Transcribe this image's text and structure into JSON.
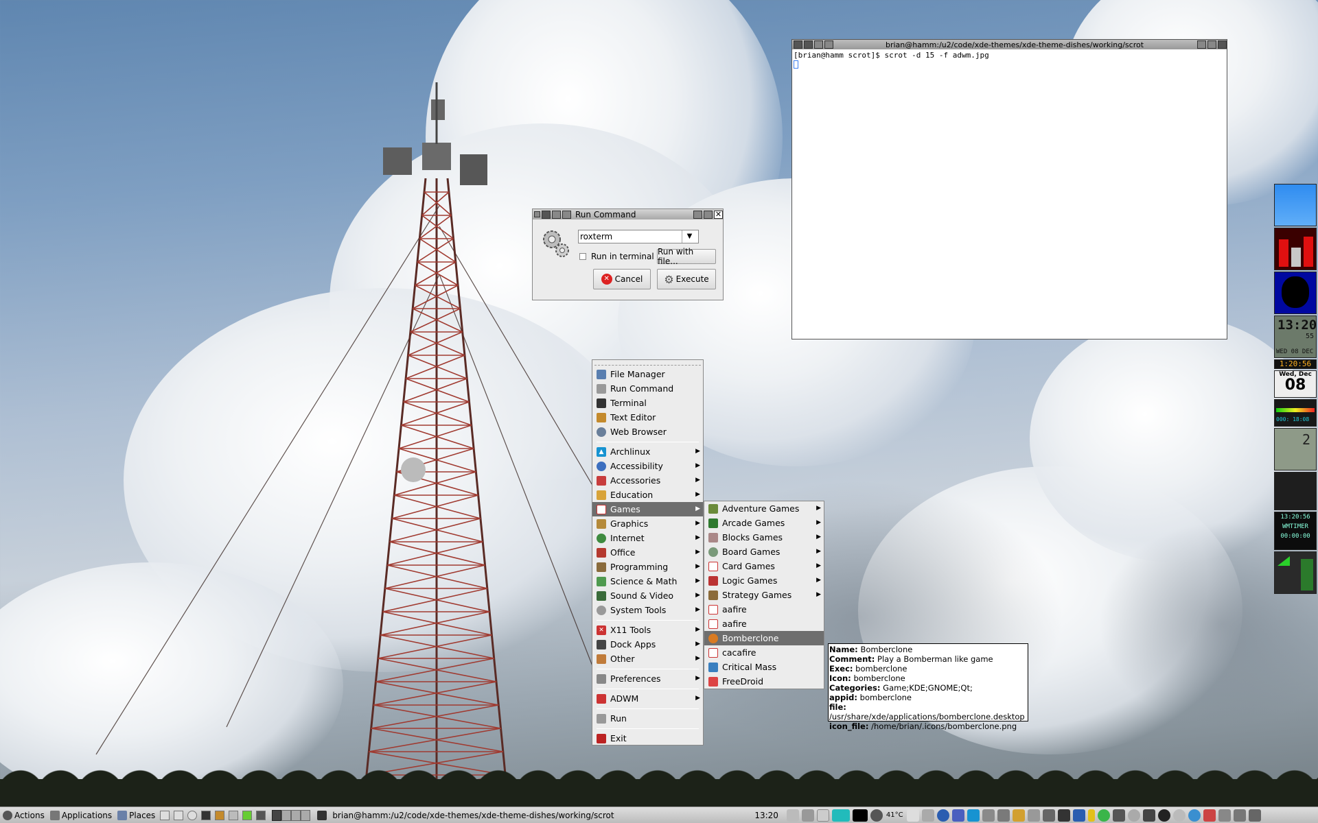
{
  "terminal": {
    "title": "brian@hamm:/u2/code/xde-themes/xde-theme-dishes/working/scrot",
    "line1": "[brian@hamm scrot]$ scrot -d 15 -f adwm.jpg"
  },
  "run_dialog": {
    "title": "Run Command",
    "command_value": "roxterm",
    "run_in_terminal_label": "Run in terminal",
    "run_with_file_label": "Run with file...",
    "cancel_label": "Cancel",
    "execute_label": "Execute"
  },
  "main_menu": {
    "top_items": [
      "File Manager",
      "Run Command",
      "Terminal",
      "Text Editor",
      "Web Browser"
    ],
    "categories": [
      "Archlinux",
      "Accessibility",
      "Accessories",
      "Education",
      "Games",
      "Graphics",
      "Internet",
      "Office",
      "Programming",
      "Science & Math",
      "Sound & Video",
      "System Tools"
    ],
    "extra": [
      "X11 Tools",
      "Dock Apps",
      "Other"
    ],
    "preferences": "Preferences",
    "adwm": "ADWM",
    "run": "Run",
    "exit": "Exit",
    "selected": "Games"
  },
  "games_menu": {
    "submenus": [
      "Adventure Games",
      "Arcade Games",
      "Blocks Games",
      "Board Games",
      "Card Games",
      "Logic Games",
      "Strategy Games"
    ],
    "apps": [
      "aafire",
      "aafire",
      "Bomberclone",
      "cacafire",
      "Critical Mass",
      "FreeDroid"
    ],
    "selected": "Bomberclone"
  },
  "tooltip": {
    "name_k": "Name:",
    "name_v": "Bomberclone",
    "comment_k": "Comment:",
    "comment_v": "Play a Bomberman like game",
    "exec_k": "Exec:",
    "exec_v": "bomberclone",
    "icon_k": "Icon:",
    "icon_v": "bomberclone",
    "categories_k": "Categories:",
    "categories_v": "Game;KDE;GNOME;Qt;",
    "appid_k": "appid:",
    "appid_v": "bomberclone",
    "file_k": "file:",
    "file_v": "/usr/share/xde/applications/bomberclone.desktop",
    "iconfile_k": "icon_file:",
    "iconfile_v": "/home/brian/.icons/bomberclone.png"
  },
  "dock": {
    "clock_time": "1:20:56",
    "date_day": "Wed, Dec",
    "date_num": "08",
    "lcd_time": "13:20",
    "lcd_sec": "55",
    "lcd_date": "WED 08 DEC",
    "timer_clock": "13:20:56",
    "timer_label": "WMTIMER",
    "timer_zero": "00:00:00",
    "cpu_pct": "2",
    "uptime": "000: 18:08"
  },
  "panel": {
    "actions": "Actions",
    "applications": "Applications",
    "places": "Places",
    "task_title": "brian@hamm:/u2/code/xde-themes/xde-theme-dishes/working/scrot",
    "clock": "13:20",
    "temp": "41°C"
  },
  "colors": {
    "menu_bg": "#ececec",
    "highlight": "#6e6e6e",
    "panel": "#cfcfcf"
  }
}
